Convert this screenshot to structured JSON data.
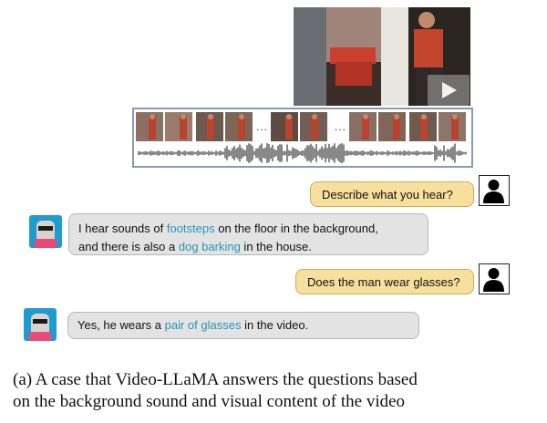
{
  "video": {
    "icons": [
      "play-icon"
    ]
  },
  "filmstrip": {
    "ellipsis": "..."
  },
  "chat": {
    "q1": "Describe what you hear?",
    "a1": {
      "line1_pre": "I hear sounds of ",
      "line1_hl": "footsteps",
      "line1_post": " on the floor in the background,",
      "line2_pre": "and there is also a ",
      "line2_hl": "dog barking",
      "line2_post": " in the house."
    },
    "q2": "Does the man wear glasses?",
    "a2": {
      "pre": "Yes, he wears a ",
      "hl": "pair of glasses",
      "post": " in the video."
    }
  },
  "caption": {
    "line1": "(a)  A case that Video-LLaMA answers the questions based",
    "line2": "on the background sound and visual content of the video"
  },
  "colors": {
    "user_bubble": "#f7df9c",
    "bot_bubble": "#e3e3e3",
    "highlight": "#2795b8"
  }
}
